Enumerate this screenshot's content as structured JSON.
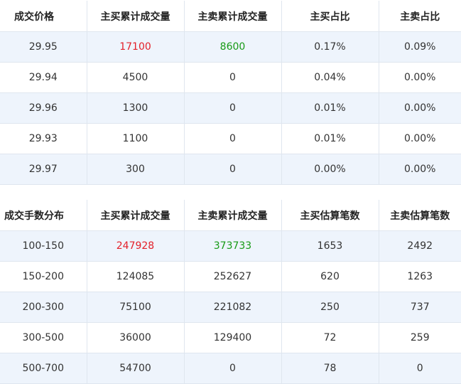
{
  "price_table": {
    "headers": [
      "成交价格",
      "主买累计成交量",
      "主卖累计成交量",
      "主买占比",
      "主卖占比"
    ],
    "rows": [
      [
        "29.95",
        "17100",
        "8600",
        "0.17%",
        "0.09%"
      ],
      [
        "29.94",
        "4500",
        "0",
        "0.04%",
        "0.00%"
      ],
      [
        "29.96",
        "1300",
        "0",
        "0.01%",
        "0.00%"
      ],
      [
        "29.93",
        "1100",
        "0",
        "0.01%",
        "0.00%"
      ],
      [
        "29.97",
        "300",
        "0",
        "0.00%",
        "0.00%"
      ]
    ]
  },
  "lot_table": {
    "headers": [
      "成交手数分布",
      "主买累计成交量",
      "主卖累计成交量",
      "主买估算笔数",
      "主卖估算笔数"
    ],
    "rows": [
      [
        "100-150",
        "247928",
        "373733",
        "1653",
        "2492"
      ],
      [
        "150-200",
        "124085",
        "252627",
        "620",
        "1263"
      ],
      [
        "200-300",
        "75100",
        "221082",
        "250",
        "737"
      ],
      [
        "300-500",
        "36000",
        "129400",
        "72",
        "259"
      ],
      [
        "500-700",
        "54700",
        "0",
        "78",
        "0"
      ]
    ]
  },
  "colors": {
    "buy_highlight": "#e3202a",
    "sell_highlight": "#179a16",
    "row_alt_bg": "#eef4fc",
    "border": "#dfe6ef"
  }
}
